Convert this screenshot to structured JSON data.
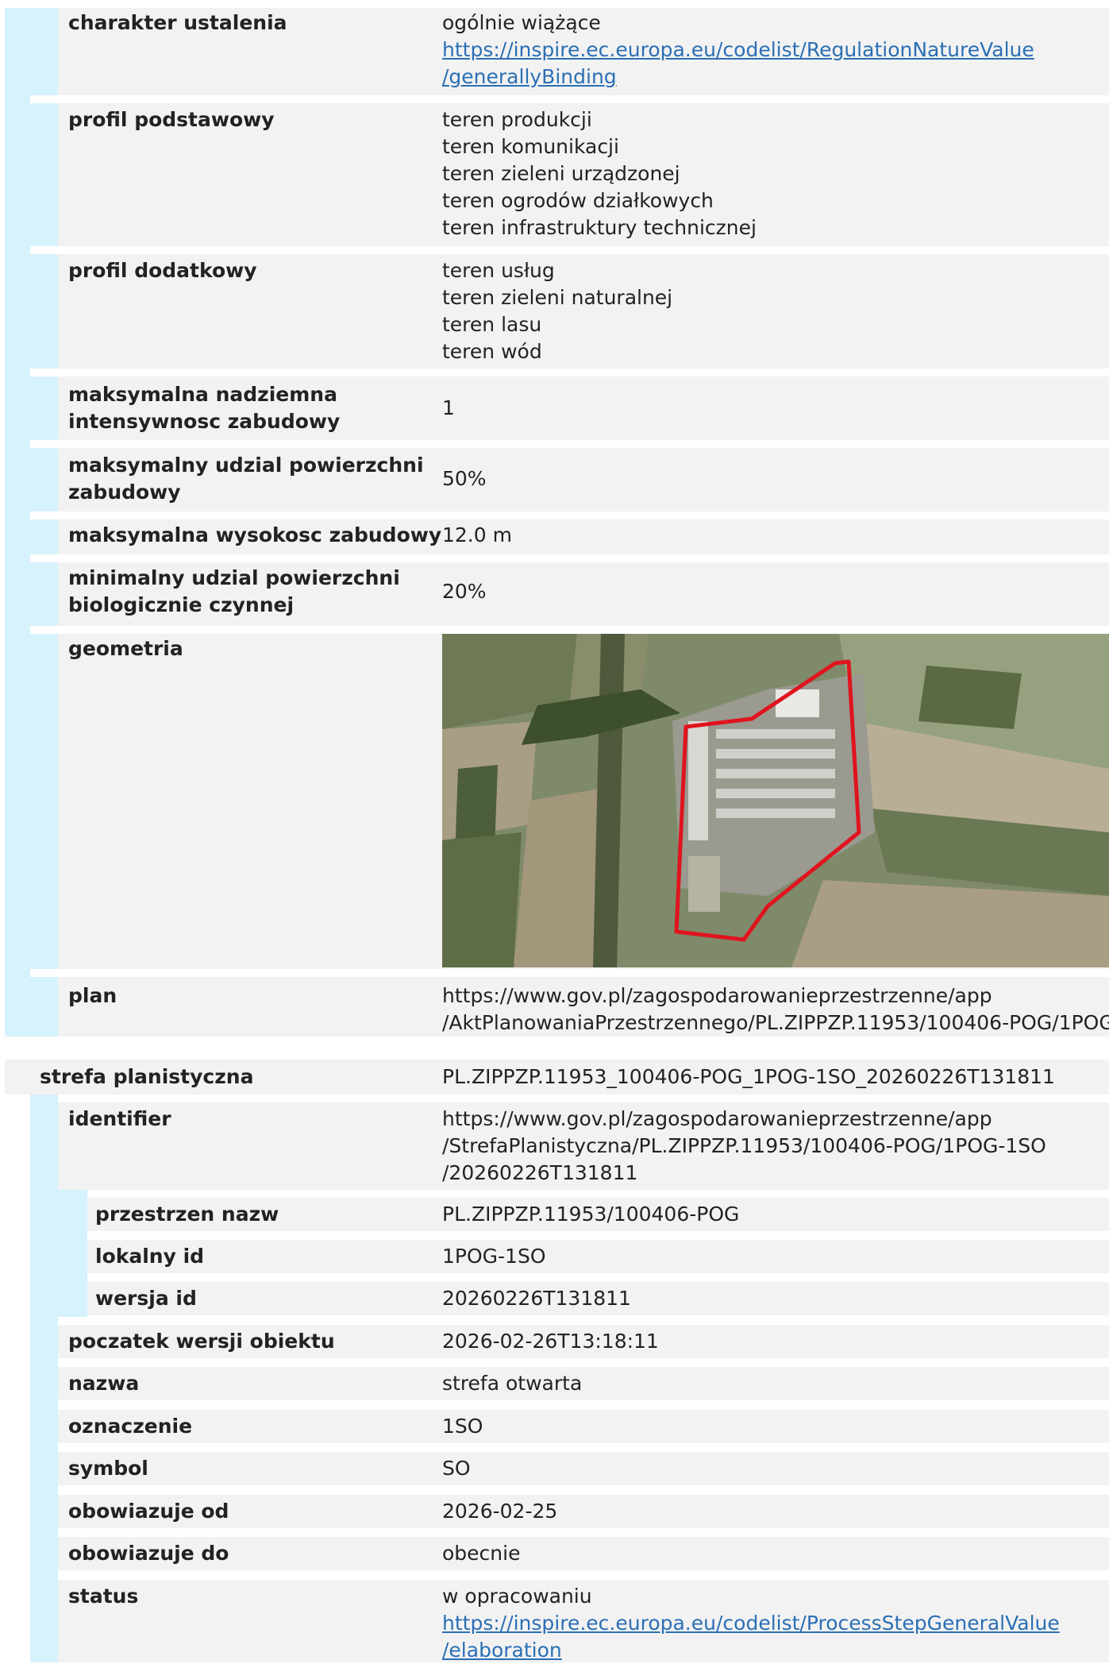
{
  "plan_rows": [
    {
      "label": "charakter ustalenia",
      "lines": [
        "ogólnie wiążące"
      ],
      "link": [
        "https://inspire.ec.europa.eu/codelist/RegulationNatureValue",
        "/generallyBinding"
      ]
    },
    {
      "label": "profil podstawowy",
      "lines": [
        "teren produkcji",
        "teren komunikacji",
        "teren zieleni urządzonej",
        "teren ogrodów działkowych",
        "teren infrastruktury technicznej"
      ]
    },
    {
      "label": "profil dodatkowy",
      "lines": [
        "teren usług",
        "teren zieleni naturalnej",
        "teren lasu",
        "teren wód"
      ]
    },
    {
      "label": [
        "maksymalna nadziemna",
        "intensywnosc zabudowy"
      ],
      "value": "1"
    },
    {
      "label": [
        "maksymalny udzial powierzchni",
        "zabudowy"
      ],
      "value": "50%"
    },
    {
      "label": "maksymalna wysokosc zabudowy",
      "value": "12.0 m"
    },
    {
      "label": [
        "minimalny udzial powierzchni",
        "biologicznie czynnej"
      ],
      "value": "20%"
    },
    {
      "label": "geometria"
    },
    {
      "label": "plan",
      "lines": [
        "https://www.gov.pl/zagospodarowanieprzestrzenne/app",
        "/AktPlanowaniaPrzestrzennego/PL.ZIPPZP.11953/100406-POG/1POG"
      ]
    }
  ],
  "strefa": {
    "label": "strefa planistyczna",
    "value": "PL.ZIPPZP.11953_100406-POG_1POG-1SO_20260226T131811",
    "identifier": {
      "label": "identifier",
      "lines": [
        "https://www.gov.pl/zagospodarowanieprzestrzenne/app",
        "/StrefaPlanistyczna/PL.ZIPPZP.11953/100406-POG/1POG-1SO",
        "/20260226T131811"
      ]
    },
    "sub": [
      {
        "label": "przestrzen nazw",
        "value": "PL.ZIPPZP.11953/100406-POG"
      },
      {
        "label": "lokalny id",
        "value": "1POG-1SO"
      },
      {
        "label": "wersja id",
        "value": "20260226T131811"
      }
    ],
    "rows": [
      {
        "label": "poczatek wersji obiektu",
        "value": "2026-02-26T13:18:11"
      },
      {
        "label": "nazwa",
        "value": "strefa otwarta"
      },
      {
        "label": "oznaczenie",
        "value": "1SO"
      },
      {
        "label": "symbol",
        "value": "SO"
      },
      {
        "label": "obowiazuje od",
        "value": "2026-02-25"
      },
      {
        "label": "obowiazuje do",
        "value": "obecnie"
      }
    ],
    "status": {
      "label": "status",
      "lines": [
        "w opracowaniu"
      ],
      "link": [
        "https://inspire.ec.europa.eu/codelist/ProcessStepGeneralValue",
        "/elaboration"
      ]
    }
  },
  "colors": {
    "bar": "#d6f2fc",
    "row_bg": "#f2f2f2",
    "link": "#2a6fb5",
    "boundary": "#e0141e"
  }
}
